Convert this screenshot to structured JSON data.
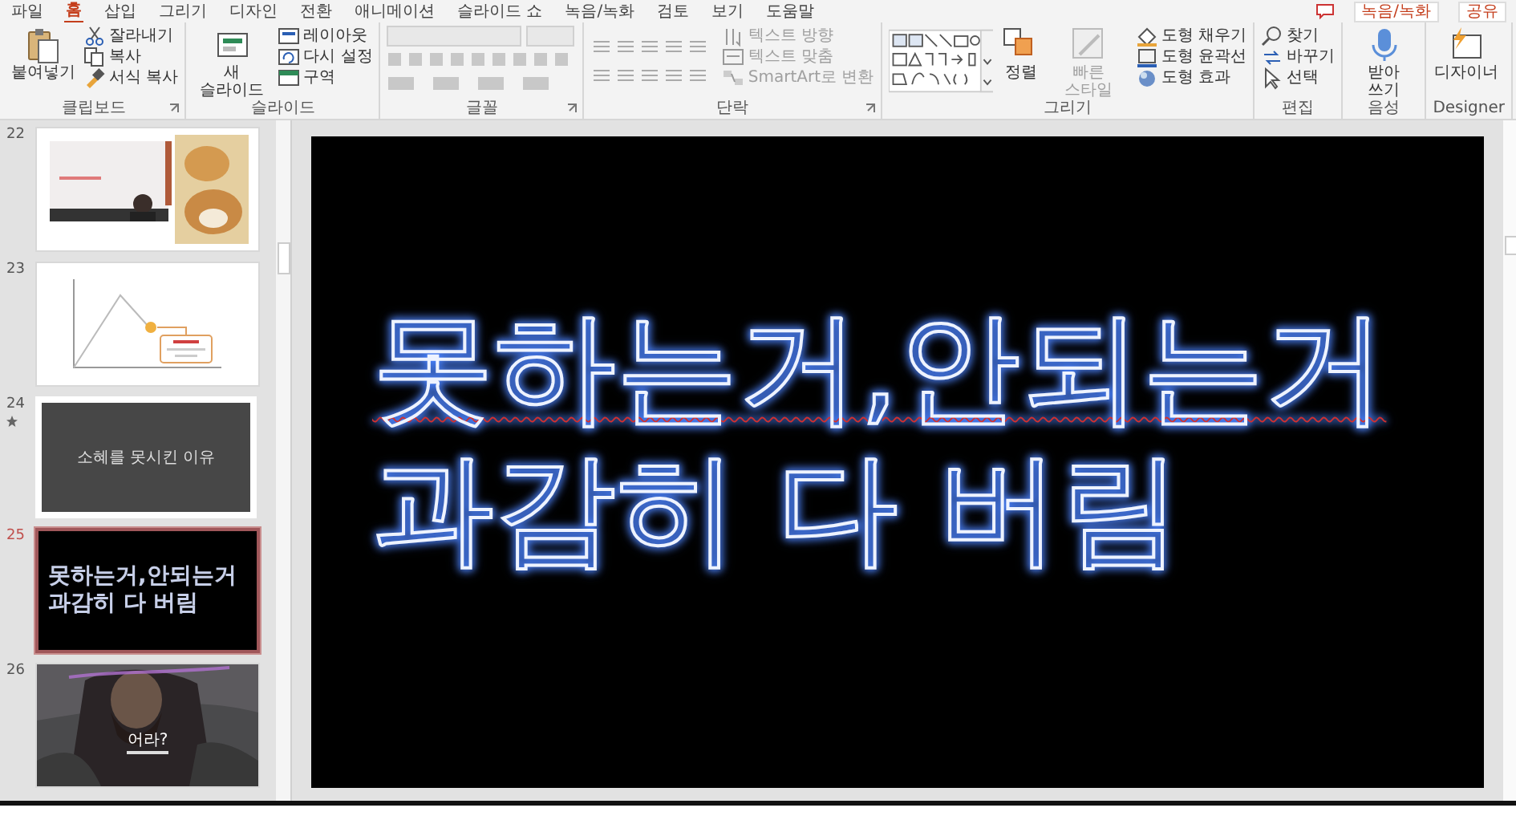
{
  "ribbon_tabs": [
    {
      "label": "파일",
      "selected": false
    },
    {
      "label": "홈",
      "selected": true
    },
    {
      "label": "삽입",
      "selected": false
    },
    {
      "label": "그리기",
      "selected": false
    },
    {
      "label": "디자인",
      "selected": false
    },
    {
      "label": "전환",
      "selected": false
    },
    {
      "label": "애니메이션",
      "selected": false
    },
    {
      "label": "슬라이드 쇼",
      "selected": false
    },
    {
      "label": "녹음/녹화",
      "selected": false
    },
    {
      "label": "검토",
      "selected": false
    },
    {
      "label": "보기",
      "selected": false
    },
    {
      "label": "도움말",
      "selected": false
    }
  ],
  "ribbon_actions": [
    {
      "label": "녹음/녹화"
    },
    {
      "label": "공유"
    }
  ],
  "ribbon_groups": [
    {
      "kind": "clipboard",
      "label": "클립보드",
      "launcher": true,
      "buttons": [
        {
          "label": "붙여넣기",
          "disabled": false
        }
      ],
      "items": [
        {
          "label": "잘라내기",
          "disabled": false
        },
        {
          "label": "복사",
          "disabled": false
        },
        {
          "label": "서식 복사",
          "disabled": false
        }
      ]
    },
    {
      "kind": "slides",
      "label": "슬라이드",
      "launcher": false,
      "buttons": [
        {
          "label": "새 슬라이드",
          "disabled": false
        }
      ],
      "items": [
        {
          "label": "레이아웃",
          "disabled": false
        },
        {
          "label": "다시 설정",
          "disabled": false
        },
        {
          "label": "구역",
          "disabled": false
        }
      ]
    },
    {
      "kind": "font",
      "label": "글꼴",
      "launcher": true
    },
    {
      "kind": "paragraph",
      "label": "단락",
      "launcher": true,
      "items": [
        {
          "label": "텍스트 방향",
          "disabled": true
        },
        {
          "label": "텍스트 맞춤",
          "disabled": true
        },
        {
          "label": "SmartArt로 변환",
          "disabled": true
        }
      ]
    },
    {
      "kind": "drawing",
      "label": "그리기",
      "launcher": false,
      "buttons": [
        {
          "label": "정렬",
          "disabled": false
        },
        {
          "label": "빠른 스타일",
          "disabled": true
        }
      ],
      "items": [
        {
          "label": "도형 채우기",
          "disabled": false
        },
        {
          "label": "도형 윤곽선",
          "disabled": false
        },
        {
          "label": "도형 효과",
          "disabled": false
        }
      ]
    },
    {
      "kind": "edit",
      "label": "편집",
      "launcher": false,
      "items": [
        {
          "label": "찾기",
          "disabled": false
        },
        {
          "label": "바꾸기",
          "disabled": false
        },
        {
          "label": "선택",
          "disabled": false
        }
      ]
    },
    {
      "kind": "voice",
      "label": "음성",
      "launcher": false,
      "buttons": [
        {
          "label": "받아 쓰기",
          "disabled": false
        }
      ]
    },
    {
      "kind": "designer",
      "label": "Designer",
      "launcher": false,
      "buttons": [
        {
          "label": "디자이너",
          "disabled": false
        }
      ]
    }
  ],
  "thumbnails": [
    {
      "number": "22",
      "kind": "collage",
      "selected": false,
      "animated": false
    },
    {
      "number": "23",
      "kind": "diagram",
      "selected": false,
      "animated": false
    },
    {
      "number": "24",
      "kind": "title",
      "text": "소혜를 못시킨 이유",
      "selected": false,
      "animated": true
    },
    {
      "number": "25",
      "kind": "neon",
      "lines": [
        "못하는거,안되는거",
        "과감히 다 버림"
      ],
      "selected": true,
      "animated": false
    },
    {
      "number": "26",
      "text": "어라?",
      "selected": false,
      "animated": false
    }
  ],
  "slide": {
    "lines": [
      {
        "text": "못하는거,안되는거",
        "spelling_error": true
      },
      {
        "text": "과감히 다 버림",
        "spelling_error": false
      }
    ]
  }
}
